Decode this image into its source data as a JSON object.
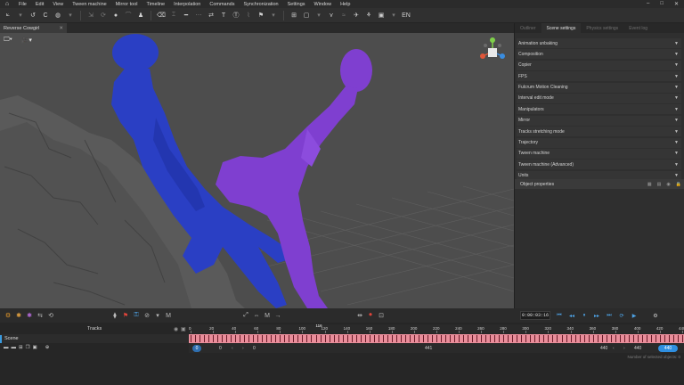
{
  "menubar": {
    "items": [
      "File",
      "Edit",
      "View",
      "Tween machine",
      "Mirror tool",
      "Timeline",
      "Interpolation",
      "Commands",
      "Synchronization",
      "Settings",
      "Window",
      "Help"
    ]
  },
  "document": {
    "tab": "Reverse Cowgirl"
  },
  "right_panel": {
    "tabs": [
      "Outliner",
      "Scene settings",
      "Physics settings",
      "Event log"
    ],
    "items": [
      "Animation unbaking",
      "Composition",
      "Copier",
      "FPS",
      "Fulcrum Motion Cleaning",
      "Interval edit mode",
      "Manipulators",
      "Mirror",
      "Tracks stretching mode",
      "Trajectory",
      "Tween machine",
      "Tween machine (Advanced)",
      "Units"
    ],
    "object_properties": "Object properties"
  },
  "bottom": {
    "time": "0:00:03:16",
    "tracks_label": "Tracks",
    "scene_label": "Scene",
    "ruler_ticks": [
      "0",
      "20",
      "40",
      "60",
      "80",
      "100",
      "120",
      "140",
      "160",
      "180",
      "200",
      "220",
      "240",
      "260",
      "280",
      "300",
      "320",
      "340",
      "360",
      "380",
      "400",
      "420",
      "440"
    ],
    "playhead": "116",
    "range_start_badge": "0",
    "range_start": "0",
    "range_start2": "0",
    "range_length": "441",
    "range_end": "440",
    "range_end2": "440",
    "range_end_badge": "440",
    "selected_info": "Number of selected objects: 0"
  },
  "colors": {
    "accent": "#3a9be0",
    "keys": "#e98d9a",
    "character_male": "#2a3fc4",
    "character_female": "#7f3fd0"
  }
}
